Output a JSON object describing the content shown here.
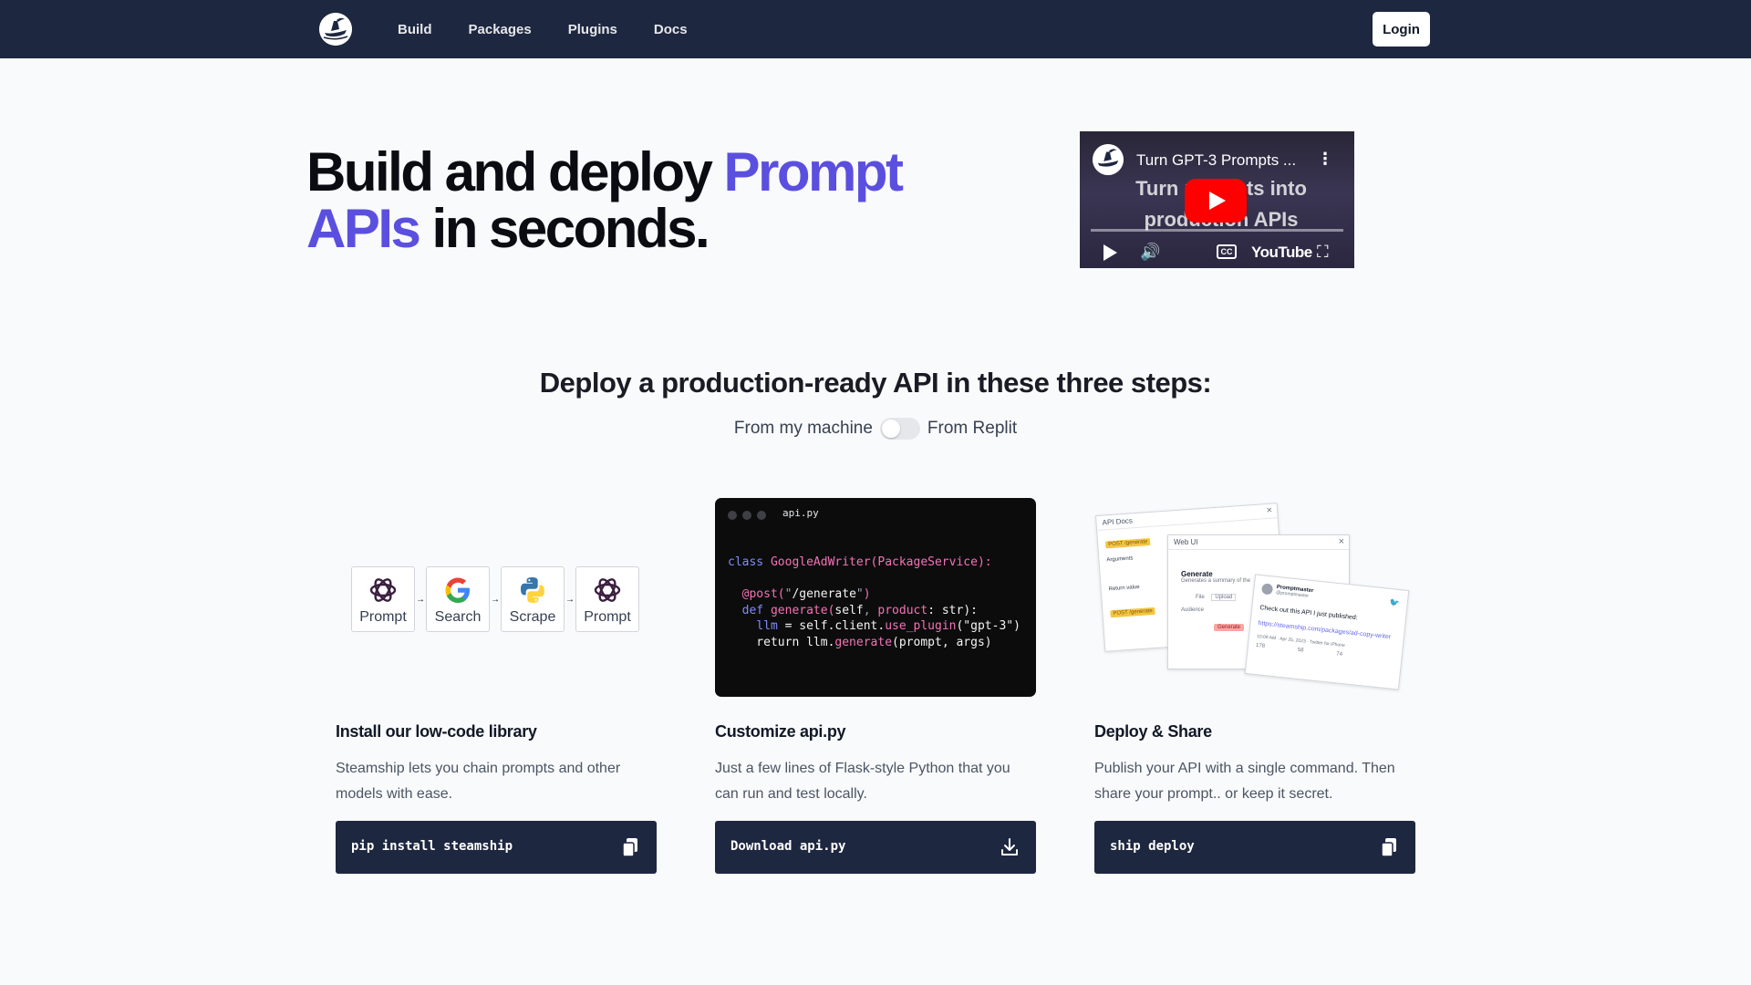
{
  "nav": {
    "links": [
      "Build",
      "Packages",
      "Plugins",
      "Docs"
    ],
    "login": "Login"
  },
  "hero": {
    "title_part1": "Build and deploy ",
    "title_accent1": "Prompt APIs",
    "title_part2": " in seconds.",
    "accent_color": "#5b4fe0"
  },
  "video": {
    "title": "Turn GPT-3 Prompts ...",
    "overlay_text": "Turn prompts into production APIs",
    "brand": "YouTube",
    "cc": "CC"
  },
  "steps": {
    "title": "Deploy a production-ready API in these three steps:",
    "toggle_left": "From my machine",
    "toggle_right": "From Replit",
    "toggle_on": false
  },
  "chain": {
    "nodes": [
      "Prompt",
      "Search",
      "Scrape",
      "Prompt"
    ],
    "icons": [
      "openai-icon",
      "google-icon",
      "python-icon",
      "openai-icon"
    ]
  },
  "code": {
    "filename": "api.py"
  },
  "deploy_ill": {
    "api_docs": "API Docs",
    "web_ui": "Web UI",
    "post_tag": "POST /generate",
    "args": "Arguments",
    "generate": "Generate",
    "generate_desc": "Generates a summary of the",
    "file": "File",
    "upload": "Upload",
    "audience": "Audience",
    "generate_btn": "Generate",
    "return_value": "Return value",
    "tweet_user": "Promptmaster",
    "tweet_handle": "@promptmaster",
    "tweet_text": "Check out this API I just published:",
    "tweet_link": "https://steamship.com/packages/ad-copy-writer",
    "tweet_meta": "10:09 AM · Apr 25, 2023 · Twitter for iPhone",
    "tweet_counts": [
      "178",
      "58",
      "74"
    ]
  },
  "columns": [
    {
      "title": "Install our low-code library",
      "desc": "Steamship lets you chain prompts and other models with ease.",
      "cmd": "pip install steamship",
      "icon": "copy-icon"
    },
    {
      "title": "Customize api.py",
      "desc": "Just a few lines of Flask-style Python that you can run and test locally.",
      "cmd": "Download api.py",
      "icon": "download-icon"
    },
    {
      "title": "Deploy & Share",
      "desc": "Publish your API with a single command. Then share your prompt.. or keep it secret.",
      "cmd": "ship deploy",
      "icon": "copy-icon"
    }
  ]
}
